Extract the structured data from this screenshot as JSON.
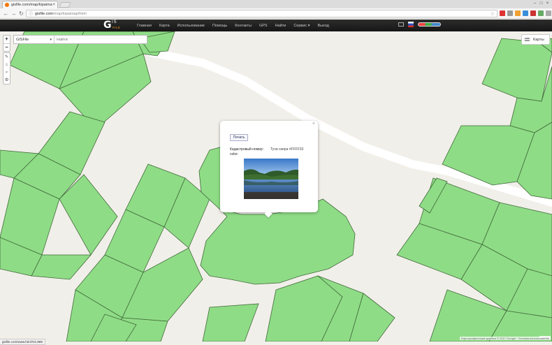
{
  "browser": {
    "tab_title": "gisfile.com/map/kipaimap",
    "tab_close": "×",
    "url_host": "gisfile.com",
    "url_path": "/map/kipaimap/html",
    "back": "←",
    "forward": "→",
    "reload": "↻",
    "star": "☆",
    "window_minimize": "–",
    "window_maximize": "□",
    "window_close": "×"
  },
  "site": {
    "logo_g": "G",
    "logo_is": "IS",
    "logo_file": "FILE",
    "menu": [
      "Главная",
      "Карта",
      "Использование",
      "Помощь",
      "Контакты",
      "GPS",
      "Найти",
      "Сервис ▾",
      "Выход"
    ]
  },
  "map_controls": {
    "zoom_in": "+",
    "zoom_out": "−",
    "layer_select": "GISFile",
    "search_placeholder": "Найти",
    "layers_label": "Карты"
  },
  "popup": {
    "close": "×",
    "print_label": "Печать",
    "field_label": "Кадастровый номер: color:",
    "field_value": "Тучи озера #FFFF33"
  },
  "status": {
    "status_url": "gisfile.com/www.html?id=989",
    "attribution": "Картографические данные © 2017 Google · Условия использования",
    "leaflet": "Leaflet"
  },
  "colors": {
    "parcel_fill": "#8fdc86",
    "parcel_stroke": "#3f6a3a",
    "map_bg": "#f1efe9"
  }
}
